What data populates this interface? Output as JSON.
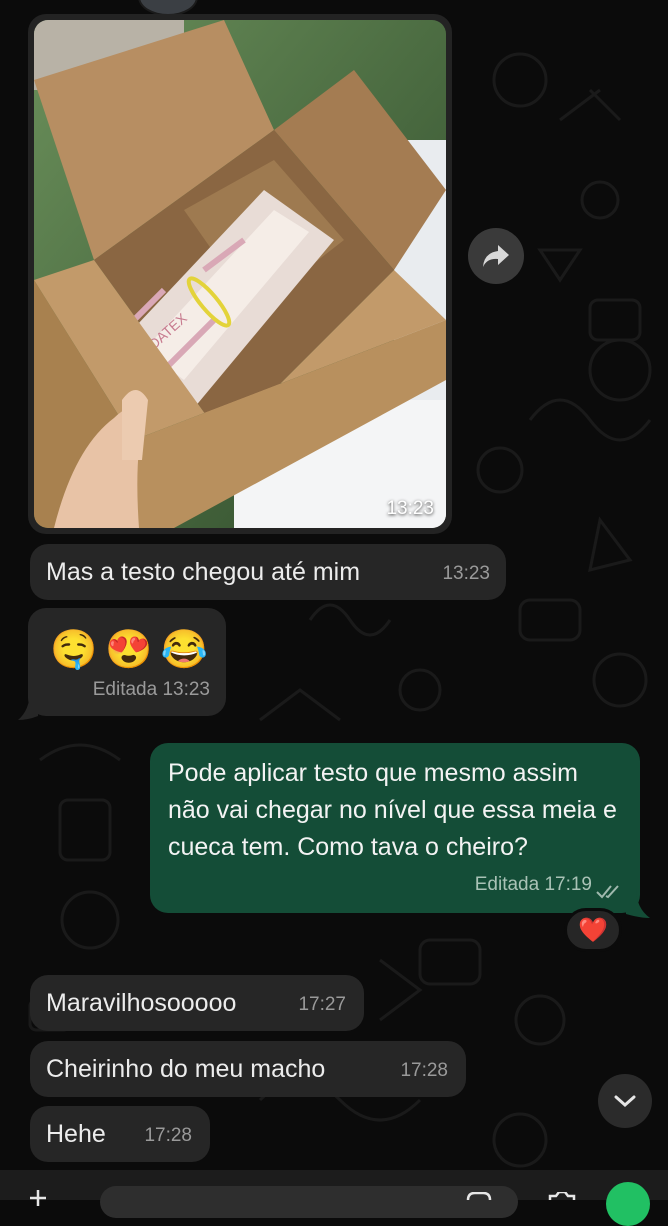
{
  "photo_message": {
    "time": "13:23",
    "label_on_package": "DATEX"
  },
  "messages": [
    {
      "text": "Mas a testo chegou até mim",
      "time": "13:23"
    },
    {
      "emojis": [
        "🤤",
        "😍",
        "😂"
      ],
      "time": "Editada 13:23"
    },
    {
      "text": "Pode aplicar testo que mesmo assim não vai chegar no nível que essa meia e cueca tem. Como tava o cheiro?",
      "time": "Editada 17:19",
      "reaction": "❤️"
    },
    {
      "text": "Maravilhosooooo",
      "time": "17:27"
    },
    {
      "text": "Cheirinho do meu macho",
      "time": "17:28"
    },
    {
      "text": "Hehe",
      "time": "17:28"
    }
  ],
  "colors": {
    "background": "#0b0b0b",
    "incoming_bubble": "#262626",
    "outgoing_bubble": "#144d37",
    "accent_green": "#21c063"
  }
}
